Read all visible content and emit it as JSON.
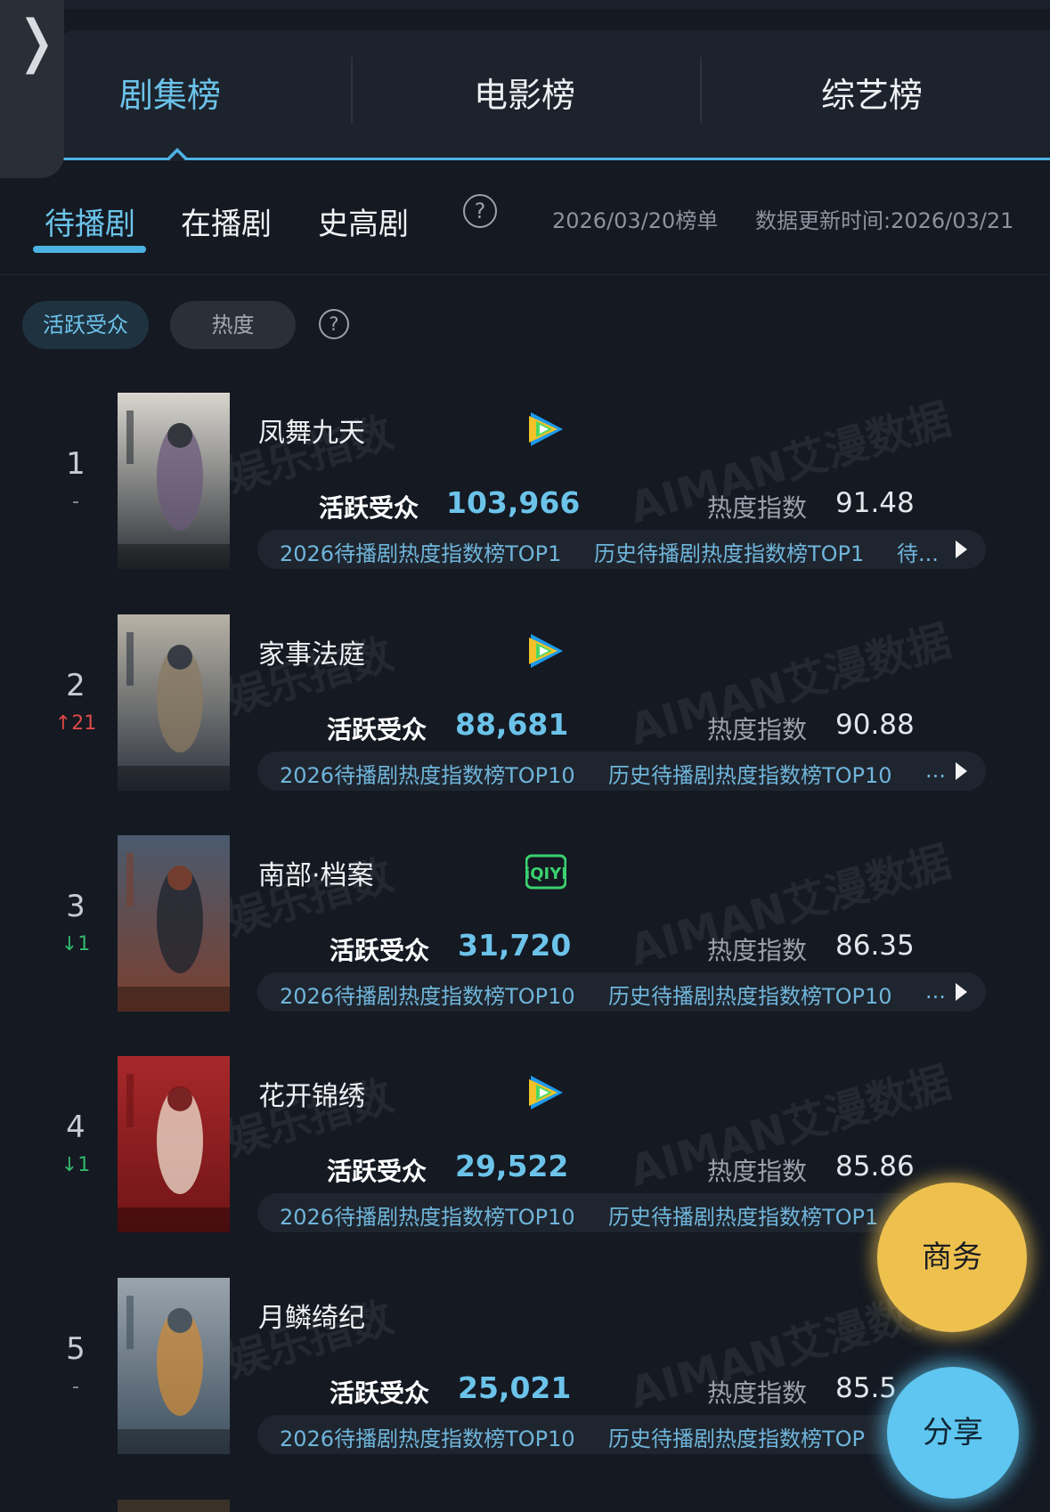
{
  "category_tabs": [
    {
      "label": "剧集榜",
      "active": true
    },
    {
      "label": "电影榜",
      "active": false
    },
    {
      "label": "综艺榜",
      "active": false
    }
  ],
  "sub_tabs": [
    {
      "label": "待播剧",
      "active": true
    },
    {
      "label": "在播剧",
      "active": false
    },
    {
      "label": "史高剧",
      "active": false
    }
  ],
  "meta": {
    "list_date": "2026/03/20榜单",
    "update_time": "数据更新时间:2026/03/21"
  },
  "filters": [
    {
      "label": "活跃受众",
      "active": true
    },
    {
      "label": "热度",
      "active": false
    }
  ],
  "metric_labels": {
    "audience": "活跃受众",
    "heat": "热度指数"
  },
  "watermark": {
    "cn": "娱乐指数",
    "brand": "AIMAN艾漫数据"
  },
  "dramas": [
    {
      "rank": "1",
      "change": "-",
      "change_type": "same",
      "title": "凤舞九天",
      "platform": "tencent-video-icon",
      "audience": "103,966",
      "heat": "91.48",
      "badges": [
        "2026待播剧热度指数榜TOP1",
        "历史待播剧热度指数榜TOP1",
        "待..."
      ],
      "poster_colors": [
        "#d9d6cf",
        "#2c3036",
        "#6b5a7a"
      ]
    },
    {
      "rank": "2",
      "change": "↑21",
      "change_type": "up",
      "title": "家事法庭",
      "platform": "tencent-video-icon",
      "audience": "88,681",
      "heat": "90.88",
      "badges": [
        "2026待播剧热度指数榜TOP10",
        "历史待播剧热度指数榜TOP10",
        "..."
      ],
      "poster_colors": [
        "#b7b2a6",
        "#2d3440",
        "#8a7a62"
      ]
    },
    {
      "rank": "3",
      "change": "↓1",
      "change_type": "down",
      "title": "南部·档案",
      "platform": "iqiyi-icon",
      "audience": "31,720",
      "heat": "86.35",
      "badges": [
        "2026待播剧热度指数榜TOP10",
        "历史待播剧热度指数榜TOP10",
        "..."
      ],
      "poster_colors": [
        "#4a5a6e",
        "#7a3f2e",
        "#1c232c"
      ]
    },
    {
      "rank": "4",
      "change": "↓1",
      "change_type": "down",
      "title": "花开锦绣",
      "platform": "tencent-video-icon",
      "audience": "29,522",
      "heat": "85.86",
      "badges": [
        "2026待播剧热度指数榜TOP10",
        "历史待播剧热度指数榜TOP1"
      ],
      "poster_colors": [
        "#a8282a",
        "#6e1416",
        "#efe2d0"
      ]
    },
    {
      "rank": "5",
      "change": "-",
      "change_type": "same",
      "title": "月鳞绮纪",
      "platform": "",
      "audience": "25,021",
      "heat": "85.5",
      "badges": [
        "2026待播剧热度指数榜TOP10",
        "历史待播剧热度指数榜TOP"
      ],
      "poster_colors": [
        "#9aa4ad",
        "#3e4f5e",
        "#c98a3a"
      ]
    }
  ],
  "fabs": {
    "business": "商务",
    "share": "分享"
  },
  "colors": {
    "accent": "#4cb2e3",
    "up": "#e04848",
    "down": "#33b86b",
    "business": "#eec14f",
    "share": "#5ec6f0"
  }
}
